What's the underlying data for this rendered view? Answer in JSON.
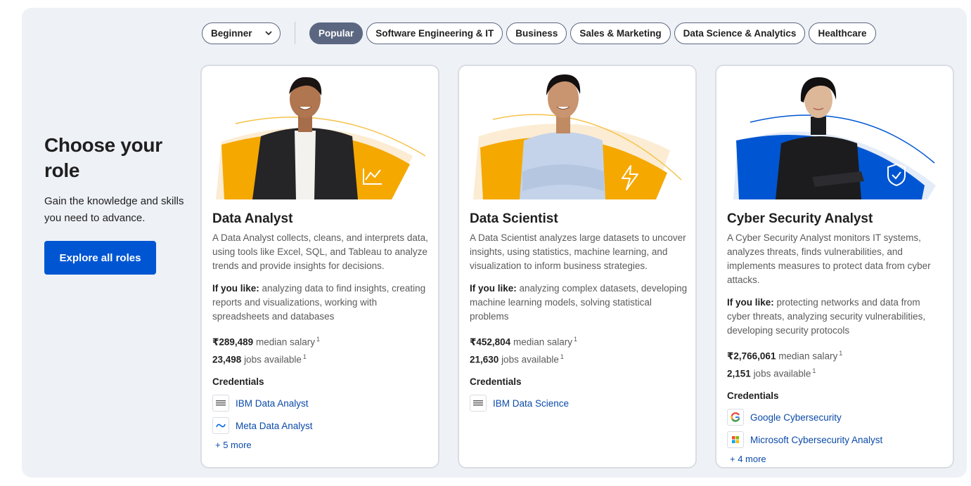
{
  "filters": {
    "level_select": "Beginner",
    "chips": [
      "Popular",
      "Software Engineering & IT",
      "Business",
      "Sales & Marketing",
      "Data Science & Analytics",
      "Healthcare"
    ],
    "active_chip": "Popular"
  },
  "intro": {
    "title": "Choose your role",
    "subtitle": "Gain the knowledge and skills you need to advance.",
    "button": "Explore all roles"
  },
  "cards": [
    {
      "title": "Data Analyst",
      "description": "A Data Analyst collects, cleans, and interprets data, using tools like Excel, SQL, and Tableau to analyze trends and provide insights for decisions.",
      "likes_label": "If you like:",
      "likes": "analyzing data to find insights, creating reports and visualizations, working with spreadsheets and databases",
      "salary": "₹289,489",
      "salary_label": "median salary",
      "jobs": "23,498",
      "jobs_label": "jobs available",
      "sup": "1",
      "credentials_label": "Credentials",
      "credentials": [
        "IBM Data Analyst",
        "Meta Data Analyst"
      ],
      "more": "+ 5 more",
      "accent": "#f5a800",
      "icon": "chart-icon"
    },
    {
      "title": "Data Scientist",
      "description": "A Data Scientist analyzes large datasets to uncover insights, using statistics, machine learning, and visualization to inform business strategies.",
      "likes_label": "If you like:",
      "likes": "analyzing complex datasets, developing machine learning models, solving statistical problems",
      "salary": "₹452,804",
      "salary_label": "median salary",
      "jobs": "21,630",
      "jobs_label": "jobs available",
      "sup": "1",
      "credentials_label": "Credentials",
      "credentials": [
        "IBM Data Science"
      ],
      "more": "",
      "accent": "#f5a800",
      "icon": "lightning-icon"
    },
    {
      "title": "Cyber Security Analyst",
      "description": "A Cyber Security Analyst monitors IT systems, analyzes threats, finds vulnerabilities, and implements measures to protect data from cyber attacks.",
      "likes_label": "If you like:",
      "likes": "protecting networks and data from cyber threats, analyzing security vulnerabilities, developing security protocols",
      "salary": "₹2,766,061",
      "salary_label": "median salary",
      "jobs": "2,151",
      "jobs_label": "jobs available",
      "sup": "1",
      "credentials_label": "Credentials",
      "credentials": [
        "Google Cybersecurity",
        "Microsoft Cybersecurity Analyst"
      ],
      "more": "+ 4 more",
      "accent": "#0056d2",
      "icon": "shield-icon"
    }
  ],
  "colors": {
    "primary": "#0056d2",
    "chip_active": "#5b6780",
    "link": "#0b4aa8",
    "panel_bg": "#eef1f6"
  }
}
